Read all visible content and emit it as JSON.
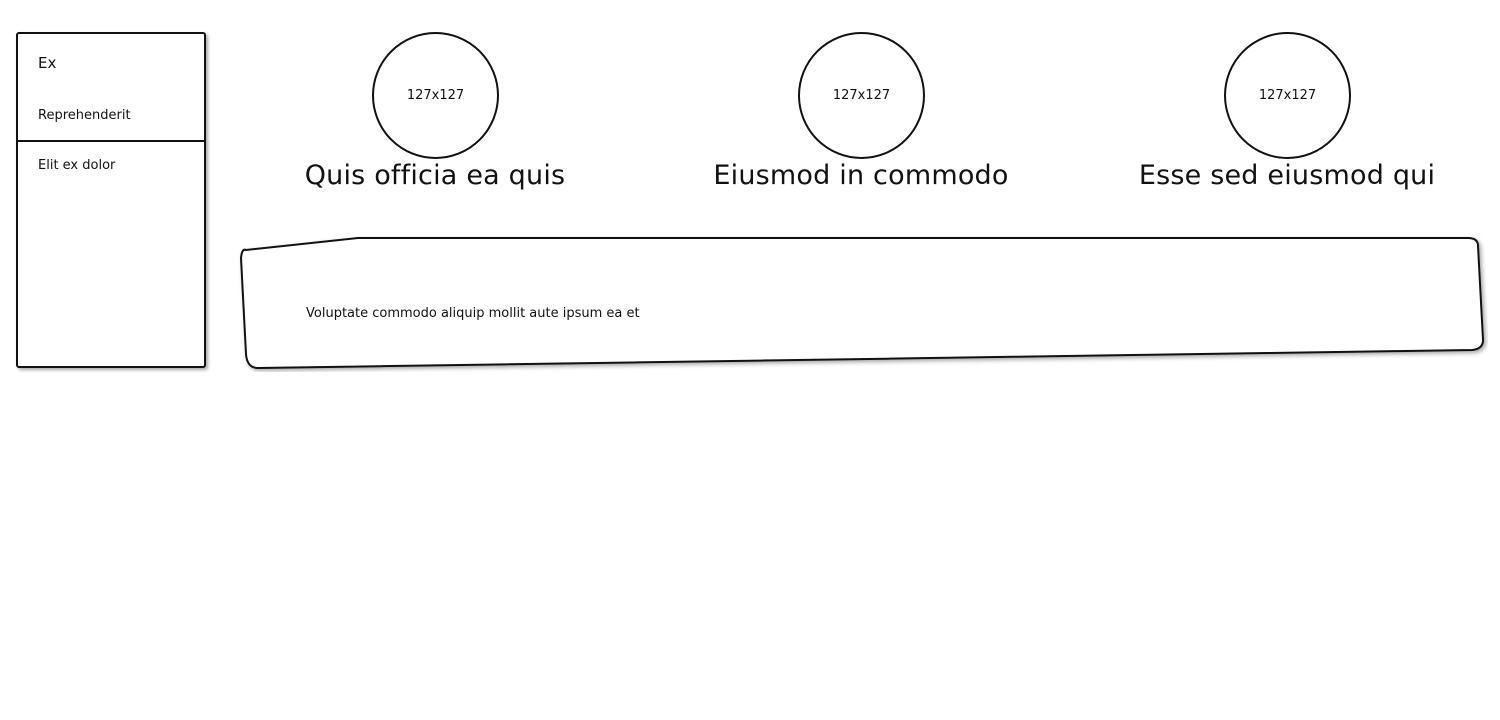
{
  "sidebar": {
    "title": "Ex",
    "items": [
      {
        "label": "Reprehenderit"
      },
      {
        "label": "Elit ex dolor"
      }
    ]
  },
  "cards": [
    {
      "image_label": "127x127",
      "title": "Quis officia ea quis"
    },
    {
      "image_label": "127x127",
      "title": "Eiusmod in commodo"
    },
    {
      "image_label": "127x127",
      "title": "Esse sed eiusmod qui"
    }
  ],
  "textbox": {
    "text": "Voluptate commodo aliquip mollit aute ipsum ea et"
  }
}
